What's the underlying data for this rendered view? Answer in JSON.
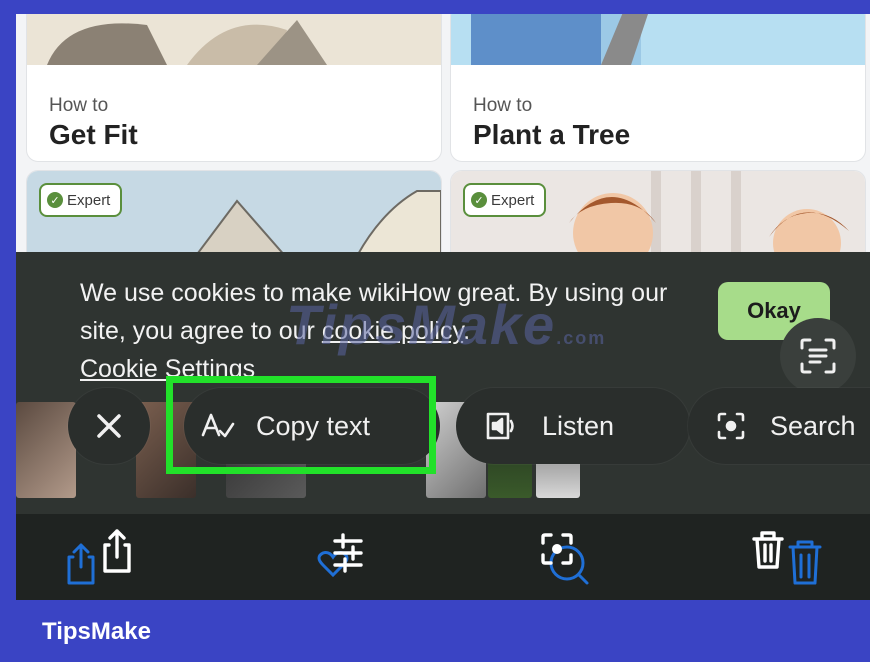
{
  "cards": [
    {
      "howto": "How to",
      "title": "Get Fit"
    },
    {
      "howto": "How to",
      "title": "Plant a Tree"
    }
  ],
  "badges": [
    {
      "label": "Expert"
    },
    {
      "label": "Expert"
    }
  ],
  "cookie": {
    "text_before": "We use cookies to make wikiHow great. By using our site, you agree to our ",
    "policy_link": "cookie policy",
    "text_after": ".",
    "settings_link": "Cookie Settings",
    "okay_label": "Okay"
  },
  "watermark": {
    "text": "TipsMake",
    "suffix": ".com"
  },
  "actions": {
    "copy_text": "Copy text",
    "listen": "Listen",
    "search": "Search"
  },
  "toolbar_icons": [
    "share-icon",
    "adjust-icon",
    "visual-lookup-icon",
    "trash-icon"
  ],
  "brand": "TipsMake",
  "colors": {
    "frame": "#3a44c4",
    "highlight": "#22e12a",
    "okay": "#a7dc8a",
    "badge": "#5a8f3c"
  }
}
